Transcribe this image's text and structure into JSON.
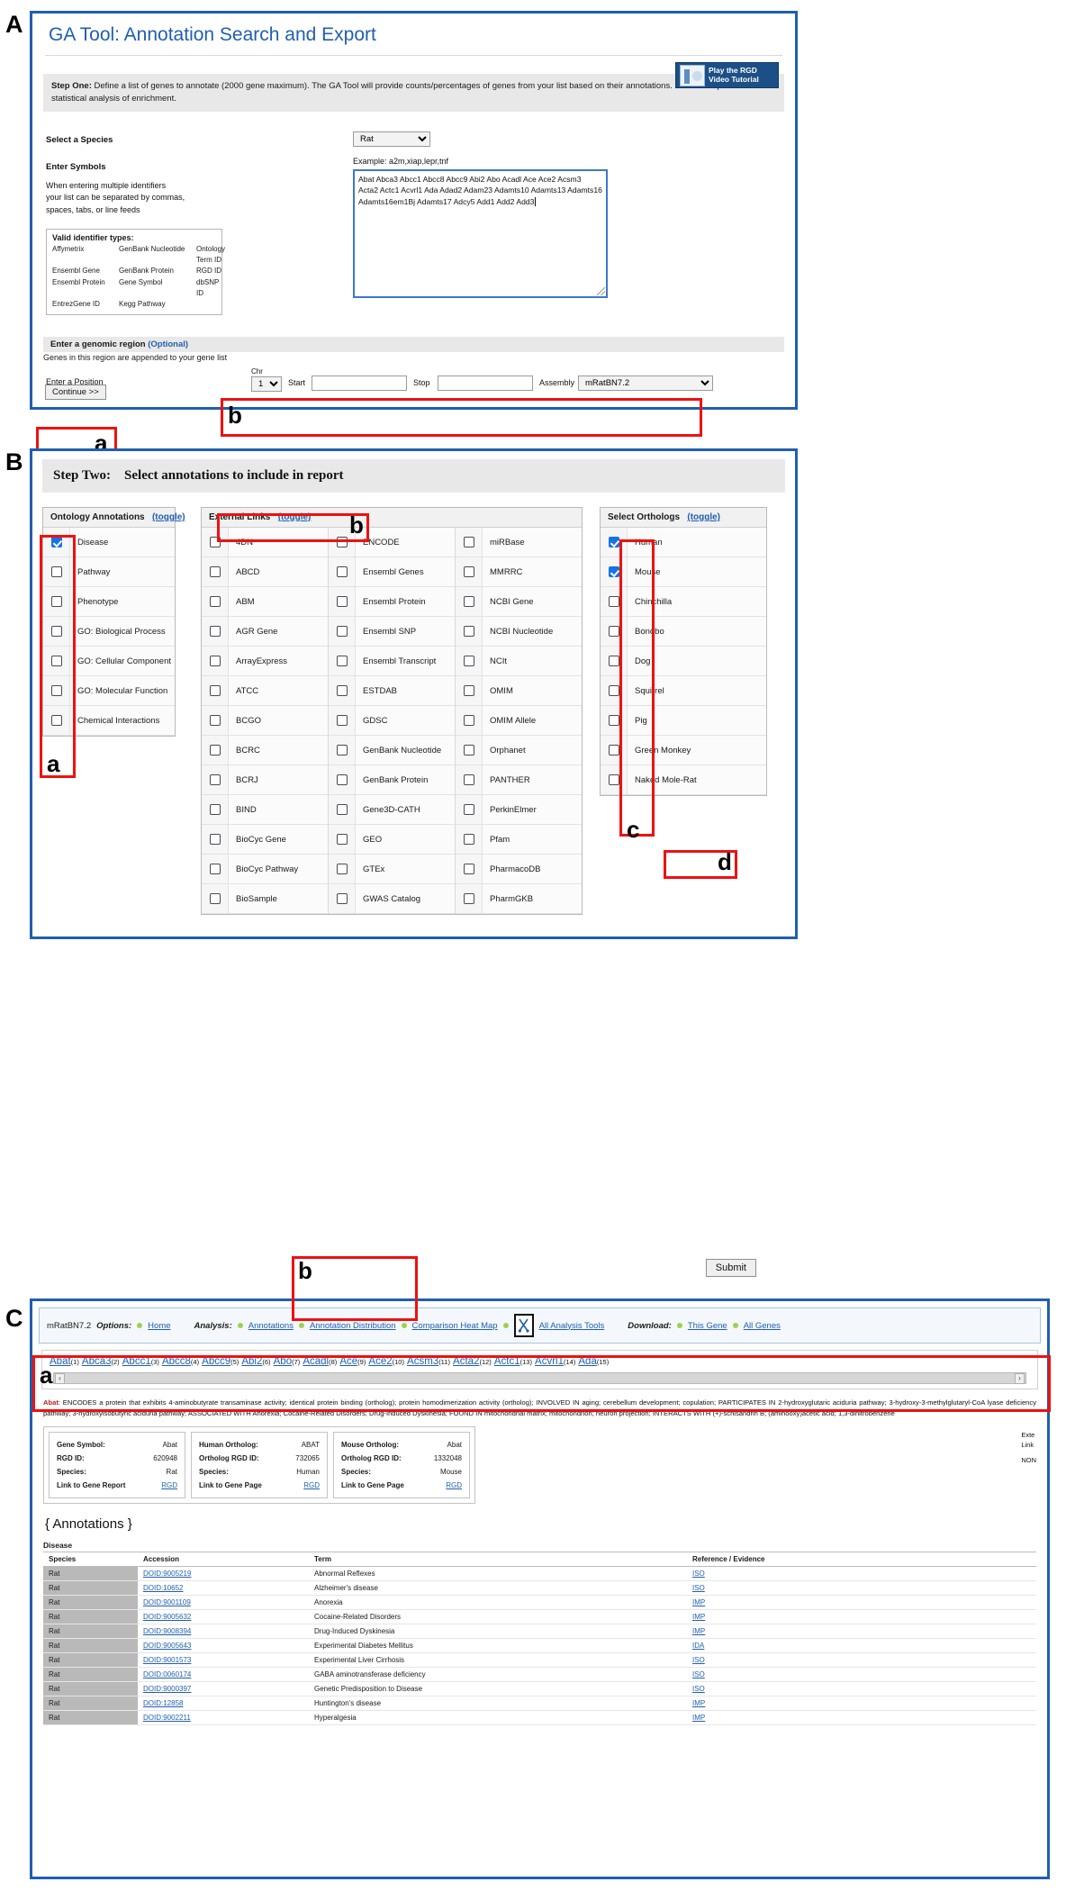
{
  "panels": {
    "a": "A",
    "b": "B",
    "c": "C"
  },
  "panelA": {
    "title": "GA Tool: Annotation Search and Export",
    "video_button": {
      "line1": "Play the RGD",
      "line2": "Video Tutorial",
      "icon": "video-thumbnail-icon"
    },
    "step_one_label": "Step One:",
    "step_one_text": "Define a list of genes to annotate (2000 gene maximum). The GA Tool will provide counts/percentages of genes from your list based on their annotations. It does not perform statistical analysis of enrichment.",
    "species_label": "Select a Species",
    "species_value": "Rat",
    "symbols_label": "Enter Symbols",
    "symbols_help": "When entering multiple identifiers\nyour list can be separated by commas,\nspaces, tabs, or line feeds",
    "valid_title": "Valid identifier types:",
    "valid_types": [
      [
        "Affymetrix",
        "GenBank Nucleotide",
        "Ontology Term ID"
      ],
      [
        "Ensembl Gene",
        "GenBank Protein",
        "RGD ID"
      ],
      [
        "Ensembl Protein",
        "Gene Symbol",
        "dbSNP ID"
      ],
      [
        "EntrezGene ID",
        "Kegg Pathway",
        ""
      ]
    ],
    "example_label": "Example: a2m,xiap,lepr,tnf",
    "textarea_value": "Abat Abca3 Abcc1 Abcc8 Abcc9 Abi2 Abo Acadl Ace Ace2 Acsm3 Acta2 Actc1 Acvrl1 Ada Adad2 Adam23 Adamts10 Adamts13 Adamts16 Adamts16em1Bj Adamts17 Adcy5 Add1 Add2 Add3",
    "genomic_label": "Enter a genomic region",
    "genomic_optional": "(Optional)",
    "genomic_sub": "Genes in this region are appended to your gene list",
    "position_label": "Enter a Position",
    "chr_label": "Chr",
    "chr_value": "1",
    "start_label": "Start",
    "start_value": "",
    "stop_label": "Stop",
    "stop_value": "",
    "assembly_label": "Assembly",
    "assembly_value": "mRatBN7.2",
    "continue_label": "Continue >>",
    "markers": {
      "a": "a",
      "b": "b"
    }
  },
  "panelB": {
    "step_two_label": "Step Two:",
    "step_two_text": "Select annotations to include in report",
    "ontology": {
      "heading": "Ontology Annotations",
      "toggle": "(toggle)",
      "items": [
        {
          "label": "Disease",
          "checked": true
        },
        {
          "label": "Pathway",
          "checked": false
        },
        {
          "label": "Phenotype",
          "checked": false
        },
        {
          "label": "GO: Biological Process",
          "checked": false
        },
        {
          "label": "GO: Cellular Component",
          "checked": false
        },
        {
          "label": "GO: Molecular Function",
          "checked": false
        },
        {
          "label": "Chemical Interactions",
          "checked": false
        }
      ]
    },
    "external": {
      "heading": "External Links",
      "toggle": "(toggle)",
      "col1": [
        "4DN",
        "ABCD",
        "ABM",
        "AGR Gene",
        "ArrayExpress",
        "ATCC",
        "BCGO",
        "BCRC",
        "BCRJ",
        "BIND",
        "BioCyc Gene",
        "BioCyc Pathway",
        "BioSample"
      ],
      "col2": [
        "ENCODE",
        "Ensembl Genes",
        "Ensembl Protein",
        "Ensembl SNP",
        "Ensembl Transcript",
        "ESTDAB",
        "GDSC",
        "GenBank Nucleotide",
        "GenBank Protein",
        "Gene3D-CATH",
        "GEO",
        "GTEx",
        "GWAS Catalog"
      ],
      "col3": [
        "miRBase",
        "MMRRC",
        "NCBI Gene",
        "NCBI Nucleotide",
        "NCIt",
        "OMIM",
        "OMIM Allele",
        "Orphanet",
        "PANTHER",
        "PerkinElmer",
        "Pfam",
        "PharmacoDB",
        "PharmGKB"
      ]
    },
    "orthologs": {
      "heading": "Select Orthologs",
      "toggle": "(toggle)",
      "items": [
        {
          "label": "Human",
          "checked": true
        },
        {
          "label": "Mouse",
          "checked": true
        },
        {
          "label": "Chinchilla",
          "checked": false
        },
        {
          "label": "Bonobo",
          "checked": false
        },
        {
          "label": "Dog",
          "checked": false
        },
        {
          "label": "Squirrel",
          "checked": false
        },
        {
          "label": "Pig",
          "checked": false
        },
        {
          "label": "Green Monkey",
          "checked": false
        },
        {
          "label": "Naked Mole-Rat",
          "checked": false
        }
      ]
    },
    "submit_label": "Submit",
    "markers": {
      "a": "a",
      "b": "b",
      "c": "c",
      "d": "d"
    }
  },
  "panelC": {
    "toolbar": {
      "assembly": "mRatBN7.2",
      "options_label": "Options:",
      "home": "Home",
      "analysis_label": "Analysis:",
      "annotations": "Annotations",
      "annotation_distribution": "Annotation Distribution",
      "comparison_heat_map": "Comparison Heat Map",
      "tools_icon": "analysis-tools-icon",
      "all_analysis_tools": "All Analysis Tools",
      "download_label": "Download:",
      "this_gene": "This Gene",
      "all_genes": "All Genes"
    },
    "gene_links": [
      {
        "name": "Abat",
        "n": "(1)"
      },
      {
        "name": "Abca3",
        "n": "(2)"
      },
      {
        "name": "Abcc1",
        "n": "(3)"
      },
      {
        "name": "Abcc8",
        "n": "(4)"
      },
      {
        "name": "Abcc9",
        "n": "(5)"
      },
      {
        "name": "Abi2",
        "n": "(6)"
      },
      {
        "name": "Abo",
        "n": "(7)"
      },
      {
        "name": "Acadl",
        "n": "(8)"
      },
      {
        "name": "Ace",
        "n": "(9)"
      },
      {
        "name": "Ace2",
        "n": "(10)"
      },
      {
        "name": "Acsm3",
        "n": "(11)"
      },
      {
        "name": "Acta2",
        "n": "(12)"
      },
      {
        "name": "Actc1",
        "n": "(13)"
      },
      {
        "name": "Acvrl1",
        "n": "(14)"
      },
      {
        "name": "Ada",
        "n": "(15)"
      }
    ],
    "scroll_left": "‹",
    "scroll_right": "›",
    "gene_name": "Abat",
    "gene_description": ": ENCODES a protein that exhibits 4-aminobutyrate transaminase activity; identical protein binding (ortholog); protein homodimerization activity (ortholog); INVOLVED IN aging; cerebellum development; copulation; PARTICIPATES IN 2-hydroxyglutaric aciduria pathway; 3-hydroxy-3-methylglutaryl-CoA lyase deficiency pathway; 3-hydroxyisobutyric aciduria pathway; ASSOCIATED WITH Anorexia; Cocaine-Related Disorders; Drug-Induced Dyskinesia; FOUND IN mitochondrial matrix; mitochondrion; neuron projection; INTERACTS WITH (+)-schisandrin B; (aminooxy)acetic acid; 1,3-dinitrobenzene",
    "cards": [
      {
        "rows": [
          {
            "k": "Gene Symbol:",
            "v": "Abat"
          },
          {
            "k": "RGD ID:",
            "v": "620948"
          },
          {
            "k": "Species:",
            "v": "Rat"
          },
          {
            "k": "Link to Gene Report",
            "v": "RGD",
            "link": true
          }
        ]
      },
      {
        "rows": [
          {
            "k": "Human Ortholog:",
            "v": "ABAT"
          },
          {
            "k": "Ortholog RGD ID:",
            "v": "732065"
          },
          {
            "k": "Species:",
            "v": "Human"
          },
          {
            "k": "Link to Gene Page",
            "v": "RGD",
            "link": true
          }
        ]
      },
      {
        "rows": [
          {
            "k": "Mouse Ortholog:",
            "v": "Abat"
          },
          {
            "k": "Ortholog RGD ID:",
            "v": "1332048"
          },
          {
            "k": "Species:",
            "v": "Mouse"
          },
          {
            "k": "Link to Gene Page",
            "v": "RGD",
            "link": true
          }
        ]
      }
    ],
    "ext_side_line1": "Exte",
    "ext_side_line2": "Link",
    "ext_side_line3": "NON",
    "annotations_heading": "{ Annotations }",
    "disease_heading": "Disease",
    "table_headers": [
      "Species",
      "Accession",
      "Term",
      "Reference / Evidence"
    ],
    "table_rows": [
      {
        "species": "Rat",
        "accession": "DOID:9005219",
        "term": "Abnormal Reflexes",
        "evidence": "ISO"
      },
      {
        "species": "Rat",
        "accession": "DOID:10652",
        "term": "Alzheimer's disease",
        "evidence": "ISO"
      },
      {
        "species": "Rat",
        "accession": "DOID:9001109",
        "term": "Anorexia",
        "evidence": "IMP"
      },
      {
        "species": "Rat",
        "accession": "DOID:9005632",
        "term": "Cocaine-Related Disorders",
        "evidence": "IMP"
      },
      {
        "species": "Rat",
        "accession": "DOID:9008394",
        "term": "Drug-Induced Dyskinesia",
        "evidence": "IMP"
      },
      {
        "species": "Rat",
        "accession": "DOID:9005643",
        "term": "Experimental Diabetes Mellitus",
        "evidence": "IDA"
      },
      {
        "species": "Rat",
        "accession": "DOID:9001573",
        "term": "Experimental Liver Cirrhosis",
        "evidence": "ISO"
      },
      {
        "species": "Rat",
        "accession": "DOID:0060174",
        "term": "GABA aminotransferase deficiency",
        "evidence": "ISO"
      },
      {
        "species": "Rat",
        "accession": "DOID:9000397",
        "term": "Genetic Predisposition to Disease",
        "evidence": "ISO"
      },
      {
        "species": "Rat",
        "accession": "DOID:12858",
        "term": "Huntington's disease",
        "evidence": "IMP"
      },
      {
        "species": "Rat",
        "accession": "DOID:9002211",
        "term": "Hyperalgesia",
        "evidence": "IMP"
      }
    ],
    "markers": {
      "a": "a",
      "b": "b"
    }
  }
}
